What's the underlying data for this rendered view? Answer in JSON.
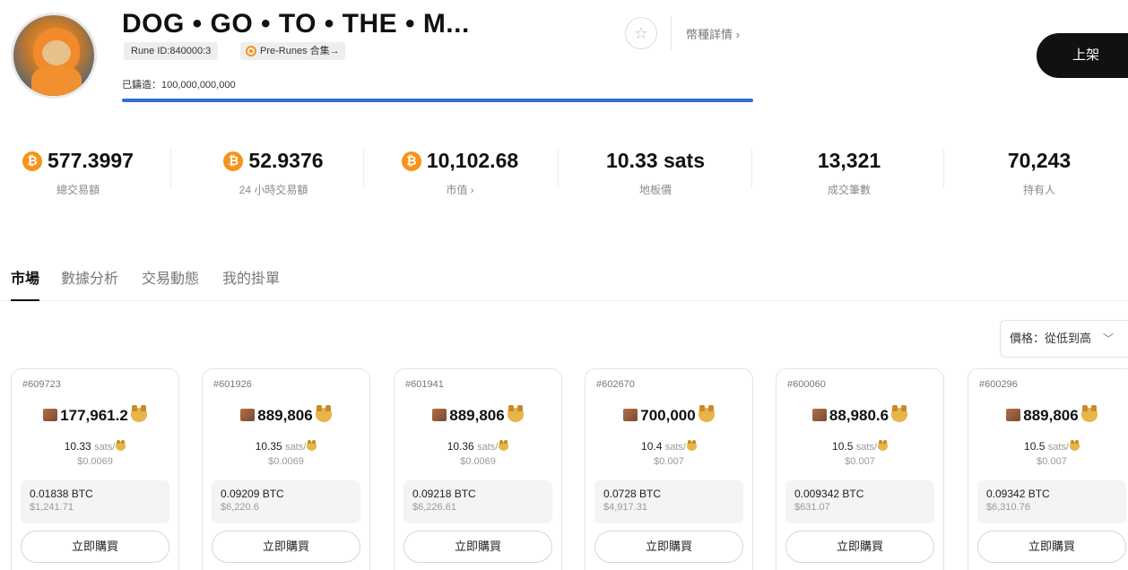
{
  "header": {
    "title": "DOG • GO • TO • THE • M...",
    "rune_id": "Rune ID:840000:3",
    "pre_runes": "Pre-Runes 合集→",
    "minted": "已鑄造：100,000,000,000",
    "detail_link": "幣種詳情 ›",
    "star_icon": "☆",
    "list_button": "上架",
    "mint_progress_percent": 100
  },
  "stats": [
    {
      "value": "577.3997",
      "label": "總交易額",
      "btc_icon": true
    },
    {
      "value": "52.9376",
      "label": "24 小時交易額",
      "btc_icon": true
    },
    {
      "value": "10,102.68",
      "label": "市值 ›",
      "btc_icon": true
    },
    {
      "value": "10.33 sats",
      "label": "地板價",
      "btc_icon": false
    },
    {
      "value": "13,321",
      "label": "成交筆數",
      "btc_icon": false
    },
    {
      "value": "70,243",
      "label": "持有人",
      "btc_icon": false
    }
  ],
  "btc_symbol": "₿",
  "tabs": [
    "市場",
    "數據分析",
    "交易動態",
    "我的掛單"
  ],
  "sort": {
    "label": "價格：從低到高",
    "chevron": "﹀"
  },
  "cards": [
    {
      "id": "#609723",
      "amount": "177,961.2",
      "unit_price": "10.33",
      "unit_suffix": "sats/",
      "unit_usd": "$0.0069",
      "total_btc": "0.01838 BTC",
      "total_usd": "$1,241.71",
      "buy": "立即購買"
    },
    {
      "id": "#601926",
      "amount": "889,806",
      "unit_price": "10.35",
      "unit_suffix": "sats/",
      "unit_usd": "$0.0069",
      "total_btc": "0.09209 BTC",
      "total_usd": "$6,220.6",
      "buy": "立即購買"
    },
    {
      "id": "#601941",
      "amount": "889,806",
      "unit_price": "10.36",
      "unit_suffix": "sats/",
      "unit_usd": "$0.0069",
      "total_btc": "0.09218 BTC",
      "total_usd": "$6,226.61",
      "buy": "立即購買"
    },
    {
      "id": "#602670",
      "amount": "700,000",
      "unit_price": "10.4",
      "unit_suffix": "sats/",
      "unit_usd": "$0.007",
      "total_btc": "0.0728 BTC",
      "total_usd": "$4,917.31",
      "buy": "立即購買"
    },
    {
      "id": "#600060",
      "amount": "88,980.6",
      "unit_price": "10.5",
      "unit_suffix": "sats/",
      "unit_usd": "$0.007",
      "total_btc": "0.009342 BTC",
      "total_usd": "$631.07",
      "buy": "立即購買"
    },
    {
      "id": "#600296",
      "amount": "889,806",
      "unit_price": "10.5",
      "unit_suffix": "sats/",
      "unit_usd": "$0.007",
      "total_btc": "0.09342 BTC",
      "total_usd": "$6,310.76",
      "buy": "立即購買"
    }
  ],
  "colors": {
    "accent_blue": "#2f6fe0",
    "btc_orange": "#f7931a",
    "dark_button": "#111111"
  }
}
